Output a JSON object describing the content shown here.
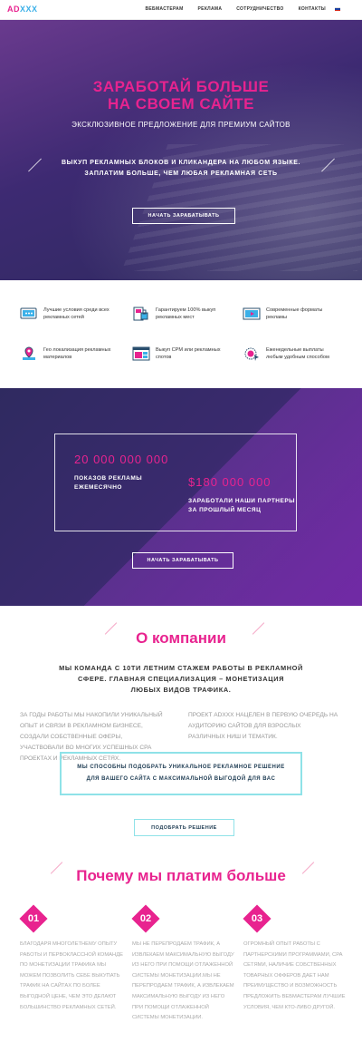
{
  "header": {
    "logo_a": "AD",
    "logo_b": "XXX",
    "nav": [
      "ВЕБМАСТЕРАМ",
      "РЕКЛАМА",
      "СОТРУДНИЧЕСТВО",
      "КОНТАКТЫ"
    ],
    "flag_colors": [
      "#ffffff",
      "#1b3fa0",
      "#d52b1e"
    ]
  },
  "hero": {
    "title_1": "ЗАРАБОТАЙ БОЛЬШЕ",
    "title_2": "НА СВОЕМ САЙТЕ",
    "subtitle": "ЭКСКЛЮЗИВНОЕ ПРЕДЛОЖЕНИЕ ДЛЯ ПРЕМИУМ САЙТОВ",
    "line_1": "ВЫКУП РЕКЛАМНЫХ БЛОКОВ И КЛИКАНДЕРА НА ЛЮБОМ ЯЗЫКЕ.",
    "line_2": "ЗАПЛАТИМ БОЛЬШЕ, ЧЕМ ЛЮБАЯ РЕКЛАМНАЯ СЕТЬ",
    "button": "НАЧАТЬ ЗАРАБАТЫВАТЬ"
  },
  "features": [
    {
      "icon": "chat-window-icon",
      "text_1": "Лучшие условия среди всех",
      "text_2": "рекламных сетей"
    },
    {
      "icon": "lock-document-icon",
      "text_1": "Гарантируем 100% выкуп",
      "text_2": "рекламных мест"
    },
    {
      "icon": "video-player-icon",
      "text_1": "Современные форматы",
      "text_2": "рекламы"
    },
    {
      "icon": "map-pin-icon",
      "text_1": "Гео локализация рекламных",
      "text_2": "материалов"
    },
    {
      "icon": "browser-layout-icon",
      "text_1": "Выкуп CPM или рекламных",
      "text_2": "спотов"
    },
    {
      "icon": "coin-cursor-icon",
      "text_1": "Еженедельные выплаты",
      "text_2": "любым удобным способом"
    }
  ],
  "stats": {
    "num_1": "20 000 000 000",
    "label_1a": "ПОКАЗОВ РЕКЛАМЫ",
    "label_1b": "ЕЖЕМЕСЯЧНО",
    "num_2": "$180 000 000",
    "label_2a": "ЗАРАБОТАЛИ НАШИ ПАРТНЕРЫ",
    "label_2b": "ЗА ПРОШЛЫЙ МЕСЯЦ",
    "button": "НАЧАТЬ ЗАРАБАТЫВАТЬ"
  },
  "about": {
    "title": "О компании",
    "lead_1": "МЫ КОМАНДА С 10ТИ ЛЕТНИМ СТАЖЕМ РАБОТЫ В РЕКЛАМНОЙ",
    "lead_2": "СФЕРЕ. ГЛАВНАЯ СПЕЦИАЛИЗАЦИЯ – МОНЕТИЗАЦИЯ",
    "lead_3": "ЛЮБЫХ ВИДОВ ТРАФИКА.",
    "left": [
      "ЗА ГОДЫ РАБОТЫ МЫ НАКОПИЛИ УНИКАЛЬНЫЙ",
      "ОПЫТ И СВЯЗИ В РЕКЛАМНОМ БИЗНЕСЕ,",
      "СОЗДАЛИ СОБСТВЕННЫЕ ОФЕРЫ,",
      "УЧАСТВОВАЛИ ВО МНОГИХ УСПЕШНЫХ CPA",
      "ПРОЕКТАХ И РЕКЛАМНЫХ СЕТЯХ."
    ],
    "right": [
      "ПРОЕКТ ADXXX НАЦЕЛЕН В ПЕРВУЮ ОЧЕРЕДЬ НА",
      "АУДИТОРИЮ САЙТОВ ДЛЯ ВЗРОСЛЫХ",
      "РАЗЛИЧНЫХ НИШ И ТЕМАТИК."
    ],
    "cta_1": "МЫ СПОСОБНЫ ПОДОБРАТЬ УНИКАЛЬНОЕ РЕКЛАМНОЕ РЕШЕНИЕ",
    "cta_2": "ДЛЯ ВАШЕГО САЙТА С МАКСИМАЛЬНОЙ ВЫГОДОЙ ДЛЯ ВАС",
    "button": "ПОДОБРАТЬ РЕШЕНИЕ"
  },
  "why": {
    "title": "Почему мы платим больше",
    "items": [
      {
        "num": "01",
        "lines": [
          "БЛАГОДАРЯ МНОГОЛЕТНЕМУ ОПЫТУ",
          "РАБОТЫ И ПЕРВОКЛАССНОЙ КОМАНДЕ",
          "ПО МОНЕТИЗАЦИИ ТРАФИКА МЫ",
          "МОЖЕМ ПОЗВОЛИТЬ СЕБЕ ВЫКУПАТЬ",
          "ТРАФИК НА САЙТАХ ПО БОЛЕЕ",
          "ВЫГОДНОЙ ЦЕНЕ, ЧЕМ ЭТО ДЕЛАЮТ",
          "БОЛЬШИНСТВО РЕКЛАМНЫХ СЕТЕЙ."
        ]
      },
      {
        "num": "02",
        "lines": [
          "МЫ НЕ ПЕРЕПРОДАЕМ ТРАФИК, А",
          "ИЗВЛЕКАЕМ МАКСИМАЛЬНУЮ ВЫГОДУ",
          "ИЗ НЕГО ПРИ ПОМОЩИ ОТЛАЖЕННОЙ",
          "СИСТЕМЫ МОНЕТИЗАЦИИ.МЫ НЕ",
          "ПЕРЕПРОДАЕМ ТРАФИК, А ИЗВЛЕКАЕМ",
          "МАКСИМАЛЬНУЮ ВЫГОДУ ИЗ НЕГО",
          "ПРИ ПОМОЩИ ОТЛАЖЕННОЙ",
          "СИСТЕМЫ МОНЕТИЗАЦИИ."
        ]
      },
      {
        "num": "03",
        "lines": [
          "ОГРОМНЫЙ ОПЫТ РАБОТЫ С",
          "ПАРТНЕРСКИМИ ПРОГРАММАМИ, CPA",
          "СЕТЯМИ, НАЛИЧИЕ СОБСТВЕННЫХ",
          "ТОВАРНЫХ ОФФЕРОВ ДАЕТ НАМ",
          "ПРЕИМУЩЕСТВО И ВОЗМОЖНОСТЬ",
          "ПРЕДЛОЖИТЬ ВЕБМАСТЕРАМ ЛУЧШИЕ",
          "УСЛОВИЯ, ЧЕМ КТО-ЛИБО ДРУГОЙ."
        ]
      }
    ]
  },
  "colors": {
    "accent": "#e8238f",
    "cyan": "#8fe2e8",
    "purple": "#3d2a72"
  }
}
